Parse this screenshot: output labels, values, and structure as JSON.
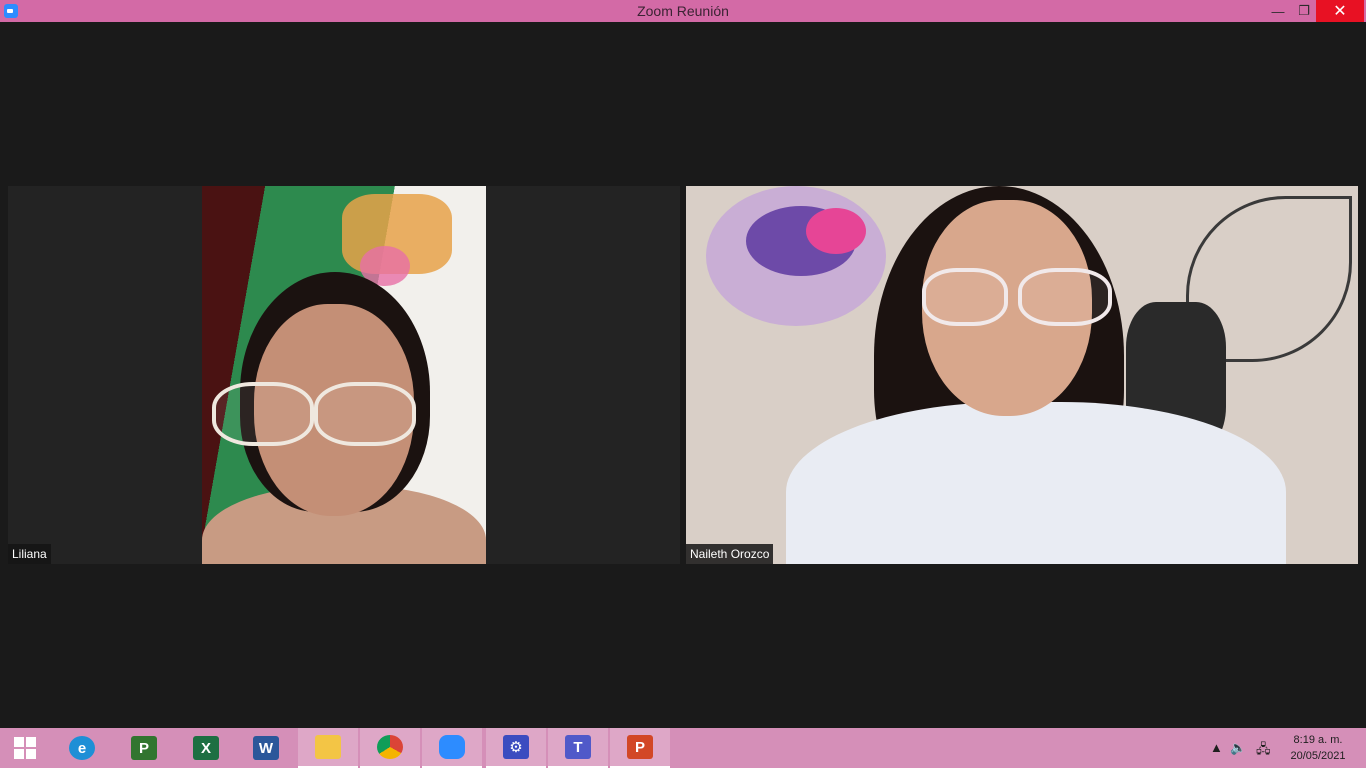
{
  "window": {
    "title": "Zoom Reunión",
    "minimize_glyph": "—",
    "maximize_glyph": "❐",
    "close_glyph": "✕",
    "accent": "#d36aa6"
  },
  "participants": [
    {
      "name": "Liliana"
    },
    {
      "name": "Naileth Orozco"
    }
  ],
  "taskbar": {
    "apps": [
      {
        "icon": "internet-explorer-icon",
        "letter": "e",
        "color": "#1e8fd6"
      },
      {
        "icon": "project-icon",
        "letter": "P",
        "color": "#31752f"
      },
      {
        "icon": "excel-icon",
        "letter": "X",
        "color": "#1d6f42"
      },
      {
        "icon": "word-icon",
        "letter": "W",
        "color": "#2b579a"
      },
      {
        "icon": "file-explorer-icon",
        "letter": "",
        "color": "#f3c545"
      },
      {
        "icon": "chrome-icon",
        "letter": "",
        "color": "#db4437"
      },
      {
        "icon": "zoom-icon",
        "letter": "",
        "color": "#2d8cff"
      },
      {
        "icon": "settings-icon",
        "letter": "⚙",
        "color": "#3b4cc0"
      },
      {
        "icon": "teams-icon",
        "letter": "T",
        "color": "#5059c9"
      },
      {
        "icon": "powerpoint-icon",
        "letter": "P",
        "color": "#d24726"
      }
    ],
    "clock": {
      "time": "8:19 a. m.",
      "date": "20/05/2021"
    }
  }
}
